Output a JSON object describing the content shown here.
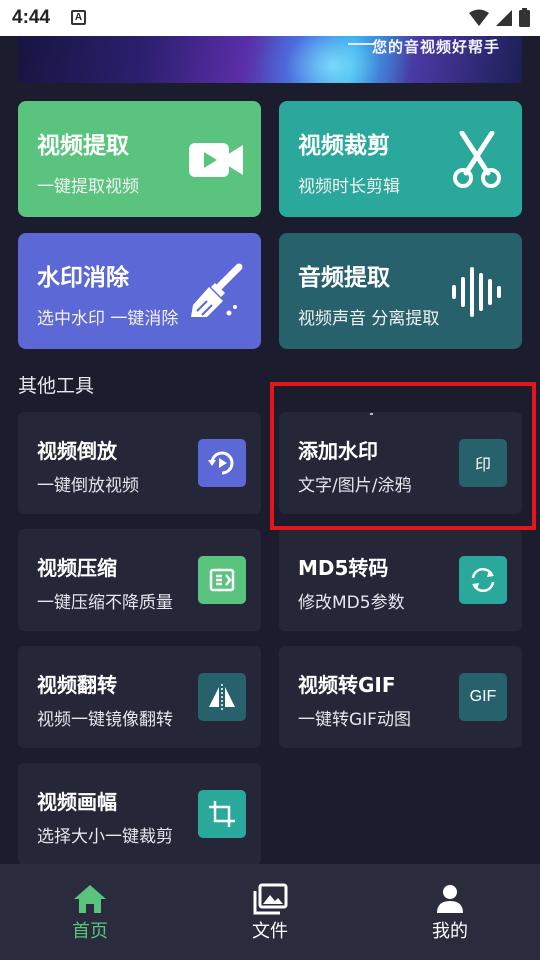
{
  "status_bar": {
    "time": "4:44",
    "a_icon": "A"
  },
  "banner": {
    "slogan": "您的音视频好帮手"
  },
  "features": [
    {
      "title": "视频提取",
      "subtitle": "一键提取视频",
      "icon": "video-camera-icon",
      "color": "#5ac47f"
    },
    {
      "title": "视频裁剪",
      "subtitle": "视频时长剪辑",
      "icon": "scissors-icon",
      "color": "#2aa89b"
    },
    {
      "title": "水印消除",
      "subtitle": "选中水印 一键消除",
      "icon": "brush-icon",
      "color": "#5b68d6"
    },
    {
      "title": "音频提取",
      "subtitle": "视频声音 分离提取",
      "icon": "waveform-icon",
      "color": "#27616c"
    }
  ],
  "section_title": "其他工具",
  "tools": [
    {
      "title": "视频倒放",
      "subtitle": "一键倒放视频",
      "icon": "reverse-icon",
      "color": "#5b68d6"
    },
    {
      "title": "添加水印",
      "subtitle": "文字/图片/涂鸦",
      "icon_text": "印",
      "color": "#27616c"
    },
    {
      "title": "视频压缩",
      "subtitle": "一键压缩不降质量",
      "icon": "compress-icon",
      "color": "#5ac47f"
    },
    {
      "title": "MD5转码",
      "subtitle": "修改MD5参数",
      "icon": "refresh-icon",
      "color": "#2aa89b"
    },
    {
      "title": "视频翻转",
      "subtitle": "视频一键镜像翻转",
      "icon": "mirror-flip-icon",
      "color": "#27616c"
    },
    {
      "title": "视频转GIF",
      "subtitle": "一键转GIF动图",
      "icon_text": "GIF",
      "color": "#27616c"
    },
    {
      "title": "视频画幅",
      "subtitle": "选择大小一键裁剪",
      "icon": "crop-icon",
      "color": "#2aa89b"
    }
  ],
  "bottom_nav": [
    {
      "label": "首页",
      "icon": "home-icon",
      "active": true,
      "color": "#5ac47f"
    },
    {
      "label": "文件",
      "icon": "gallery-icon",
      "active": false
    },
    {
      "label": "我的",
      "icon": "person-icon",
      "active": false
    }
  ]
}
